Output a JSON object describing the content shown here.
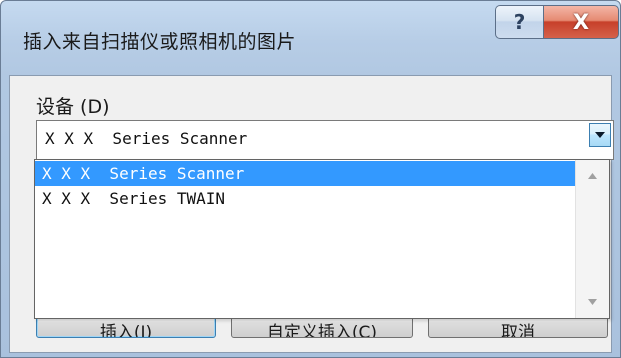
{
  "window": {
    "title": "插入来自扫描仪或照相机的图片",
    "help_glyph": "?",
    "close_glyph": "X"
  },
  "device": {
    "label": "设备 (D)",
    "selected_value": "X X X  Series Scanner",
    "options": [
      {
        "label": "X X X  Series Scanner",
        "selected": true
      },
      {
        "label": "X X X  Series TWAIN",
        "selected": false
      }
    ]
  },
  "buttons": {
    "insert": "插入(I)",
    "custom_insert": "自定义插入(C)",
    "cancel": "取消"
  },
  "icons": {
    "combo_arrow": "chevron-down-icon",
    "scroll_up": "scroll-up-arrow-icon",
    "scroll_down": "scroll-down-arrow-icon"
  },
  "colors": {
    "selection": "#3399ff",
    "close_button": "#c7402a",
    "title_bar": "#b7cde6"
  }
}
